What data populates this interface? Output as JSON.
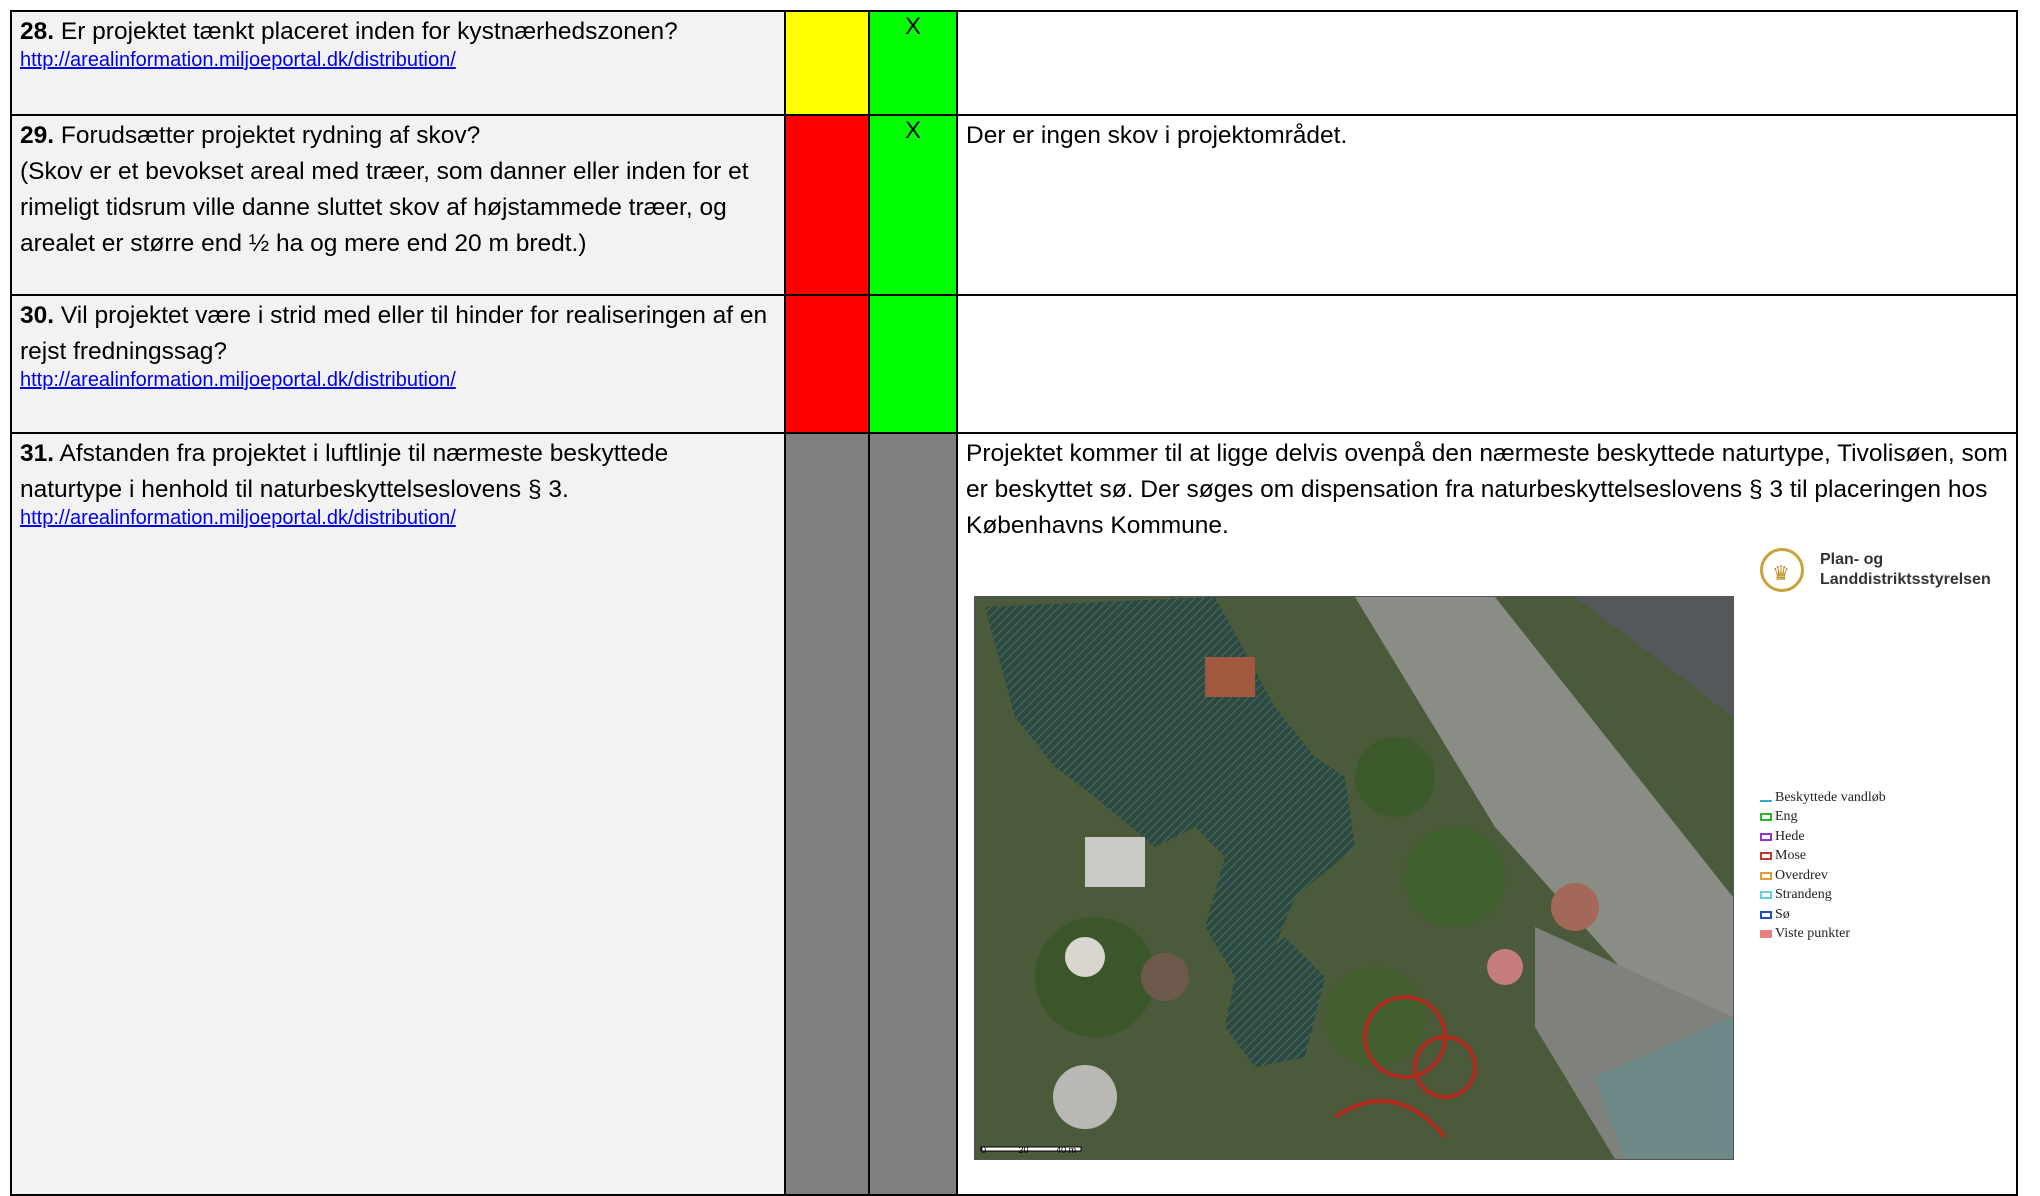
{
  "rows": [
    {
      "number": "28.",
      "question": " Er projektet tænkt placeret inden for kystnærhedszonen?",
      "link": "http://arealinformation.miljoeportal.dk/distribution/",
      "col1_color": "#ffff00",
      "col2_color": "#00ff00",
      "col1_mark": "",
      "col2_mark": "X",
      "comment": ""
    },
    {
      "number": "29.",
      "question": " Forudsætter projektet rydning af skov?",
      "question_extra": "(Skov er et bevokset areal med træer, som danner eller inden for et rimeligt tidsrum ville danne sluttet skov af højstammede træer, og arealet er større end ½ ha og mere end 20 m bredt.)",
      "link": "",
      "col1_color": "#ff0000",
      "col2_color": "#00ff00",
      "col1_mark": "",
      "col2_mark": "X",
      "comment": "Der er ingen skov i projektområdet."
    },
    {
      "number": "30.",
      "question": " Vil projektet være i strid med eller til hinder for realiseringen af en rejst fredningssag?",
      "link": "http://arealinformation.miljoeportal.dk/distribution/",
      "col1_color": "#ff0000",
      "col2_color": "#00ff00",
      "col1_mark": "",
      "col2_mark": "",
      "comment": ""
    },
    {
      "number": "31.",
      "question": " Afstanden fra projektet i luftlinje til nærmeste beskyttede naturtype i henhold til naturbeskyttelseslovens § 3.",
      "link": "http://arealinformation.miljoeportal.dk/distribution/",
      "col1_color": "#808080",
      "col2_color": "#808080",
      "col1_mark": "",
      "col2_mark": "",
      "comment": "Projektet kommer til at ligge delvis ovenpå den nærmeste beskyttede naturtype, Tivolisøen, som er beskyttet sø. Der søges om dispensation fra naturbeskyttelseslovens § 3 til placeringen hos Københavns Kommune."
    }
  ],
  "map": {
    "logo_line1": "Plan- og",
    "logo_line2": "Landdistriktsstyrelsen",
    "logo_icon": "crown-icon",
    "scale_labels": [
      "0",
      "20",
      "40 m"
    ],
    "legend": [
      {
        "label": "Beskyttede vandløb",
        "color": "#33aacc"
      },
      {
        "label": "Eng",
        "color": "#2bb52b"
      },
      {
        "label": "Hede",
        "color": "#9933cc"
      },
      {
        "label": "Mose",
        "color": "#c0392b"
      },
      {
        "label": "Overdrev",
        "color": "#e0a030"
      },
      {
        "label": "Strandeng",
        "color": "#66ccee"
      },
      {
        "label": "Sø",
        "color": "#1f4fbf"
      },
      {
        "label": "Viste punkter",
        "color": "#e88080"
      }
    ]
  }
}
